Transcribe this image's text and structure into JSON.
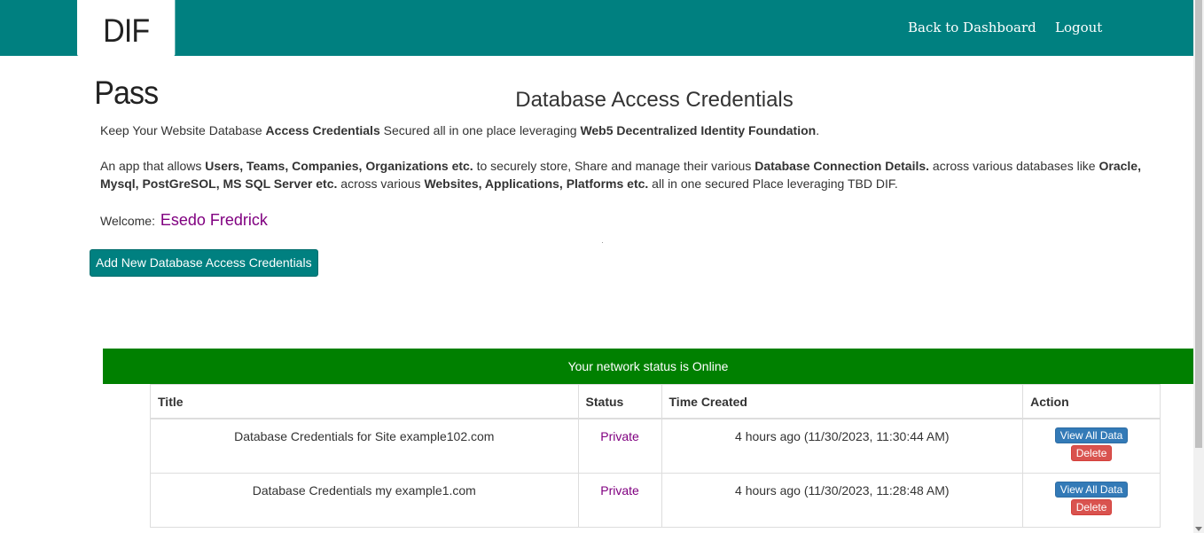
{
  "header": {
    "logo_text": "DIF Pass",
    "nav": {
      "dashboard": "Back to Dashboard",
      "logout": "Logout"
    }
  },
  "main": {
    "title": "Database Access Credentials",
    "intro1": {
      "a": "Keep Your Website Database ",
      "b": "Access Credentials",
      "c": " Secured all in one place leveraging ",
      "d": "Web5 Decentralized Identity Foundation",
      "e": "."
    },
    "intro2": {
      "a": "An app that allows ",
      "b": "Users, Teams, Companies, Organizations etc.",
      "c": " to securely store, Share and manage their various ",
      "d": "Database Connection Details.",
      "e": " across various databases like ",
      "f": "Oracle, Mysql, PostGreSOL, MS SQL Server etc.",
      "g": " across various ",
      "h": "Websites, Applications, Platforms etc.",
      "i": " all in one secured Place leveraging TBD DIF."
    },
    "welcome_label": "Welcome:",
    "user_name": "Esedo Fredrick",
    "add_button": "Add New Database Access Credentials",
    "network_status": "Your network status is Online"
  },
  "table": {
    "headers": [
      "Title",
      "Status",
      "Time Created",
      "Action"
    ],
    "rows": [
      {
        "title": "Database Credentials for Site example102.com",
        "status": "Private",
        "time": "4 hours ago (11/30/2023, 11:30:44 AM)",
        "view": "View All Data",
        "delete": "Delete"
      },
      {
        "title": "Database Credentials my example1.com",
        "status": "Private",
        "time": "4 hours ago (11/30/2023, 11:28:48 AM)",
        "view": "View All Data",
        "delete": "Delete"
      }
    ]
  },
  "colors": {
    "header": "#008080",
    "status_online": "#008000",
    "username": "#800080",
    "view_button": "#337ab7",
    "delete_button": "#d9534f"
  }
}
